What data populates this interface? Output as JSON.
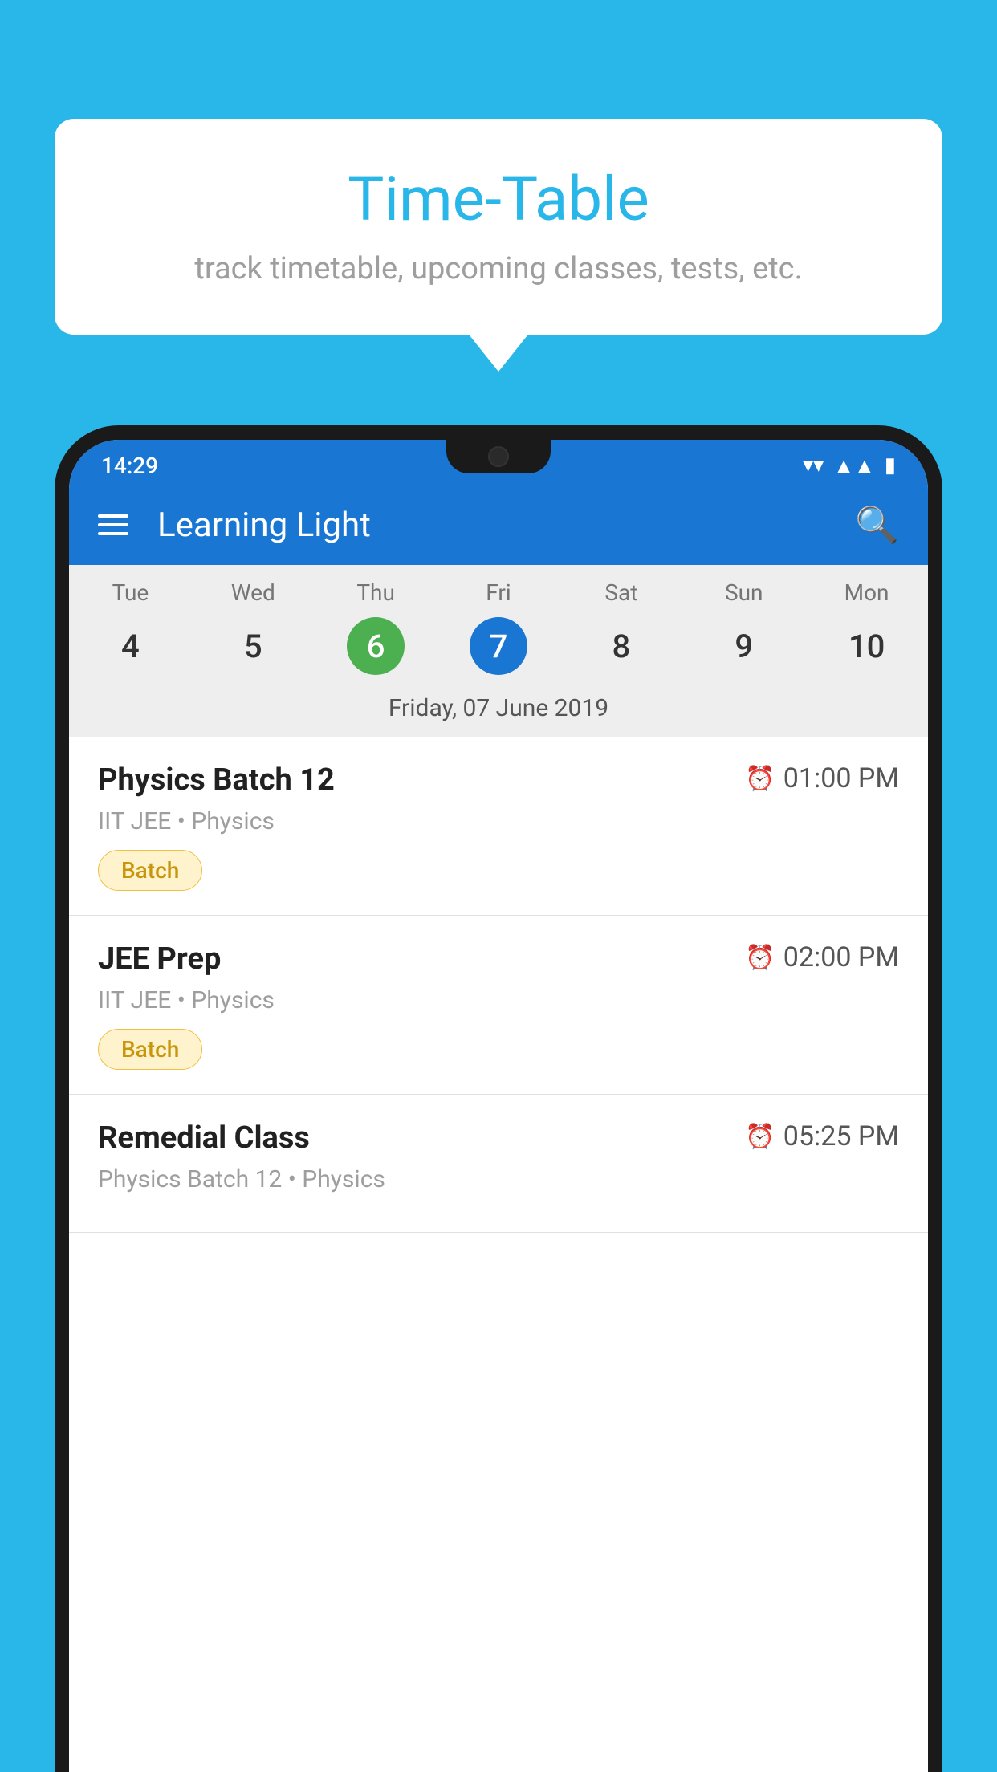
{
  "background_color": "#29b6e8",
  "speech_bubble": {
    "title": "Time-Table",
    "subtitle": "track timetable, upcoming classes, tests, etc."
  },
  "phone": {
    "status_bar": {
      "time": "14:29"
    },
    "app_bar": {
      "title": "Learning Light"
    },
    "calendar": {
      "day_headers": [
        "Tue",
        "Wed",
        "Thu",
        "Fri",
        "Sat",
        "Sun",
        "Mon"
      ],
      "day_numbers": [
        "4",
        "5",
        "6",
        "7",
        "8",
        "9",
        "10"
      ],
      "today_index": 2,
      "selected_index": 3,
      "selected_date_label": "Friday, 07 June 2019"
    },
    "schedule_items": [
      {
        "title": "Physics Batch 12",
        "time": "01:00 PM",
        "subtitle": "IIT JEE • Physics",
        "badge": "Batch"
      },
      {
        "title": "JEE Prep",
        "time": "02:00 PM",
        "subtitle": "IIT JEE • Physics",
        "badge": "Batch"
      },
      {
        "title": "Remedial Class",
        "time": "05:25 PM",
        "subtitle": "Physics Batch 12 • Physics",
        "badge": null
      }
    ]
  }
}
